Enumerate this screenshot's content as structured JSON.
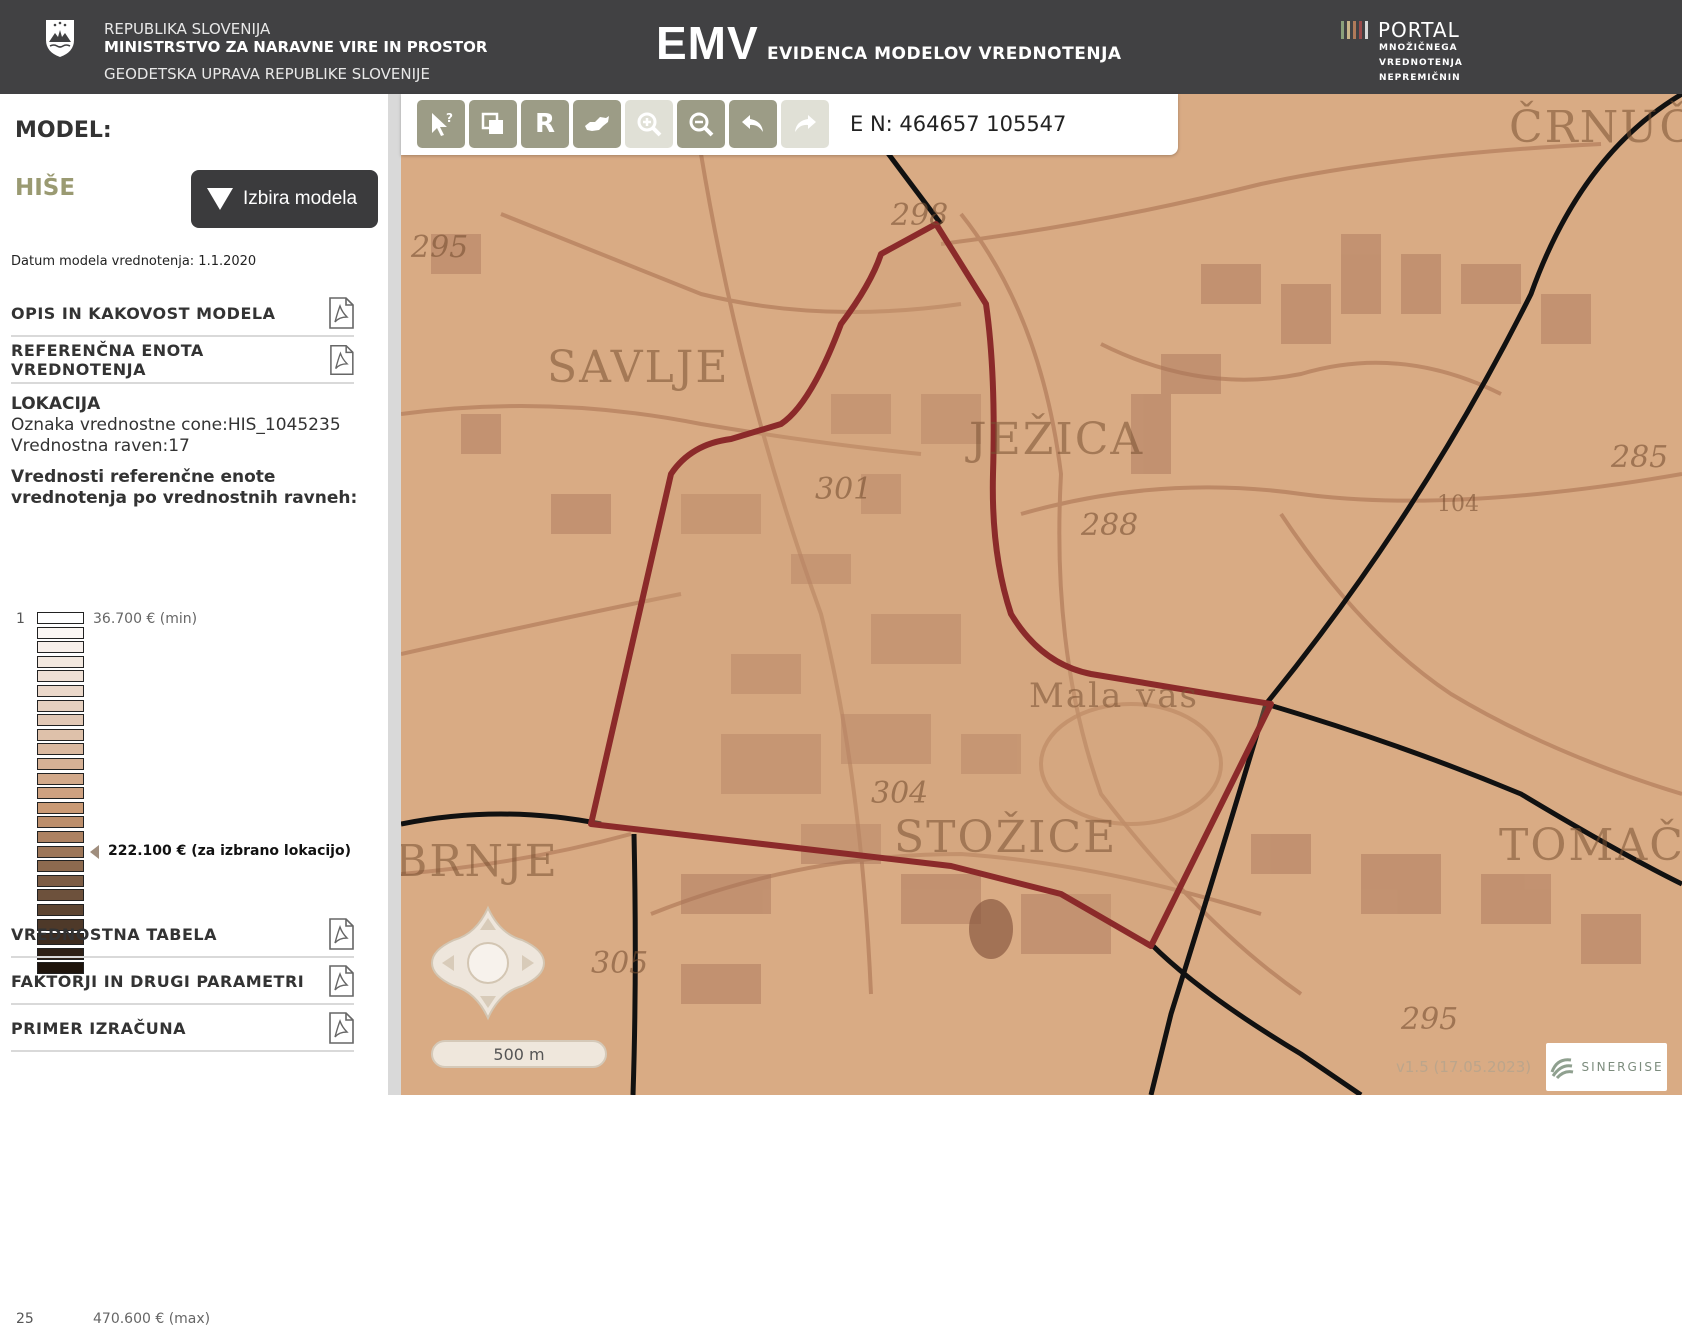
{
  "header": {
    "gov_line1": "REPUBLIKA SLOVENIJA",
    "gov_line2": "MINISTRSTVO ZA NARAVNE VIRE IN PROSTOR",
    "gov_line3": "GEODETSKA UPRAVA REPUBLIKE SLOVENIJE",
    "app_title": "EMV",
    "app_subtitle": "EVIDENCA MODELOV VREDNOTENJA",
    "portal_title": "PORTAL",
    "portal_sub1": "MNOŽIČNEGA",
    "portal_sub2": "VREDNOTENJA",
    "portal_sub3": "NEPREMIČNIN"
  },
  "sidebar": {
    "model_label": "MODEL:",
    "model_name": "HIŠE",
    "model_button": "Izbira modela",
    "model_date": "Datum modela vrednotenja:  1.1.2020",
    "sections_top": [
      {
        "label": "OPIS IN KAKOVOST MODELA"
      },
      {
        "label": "REFERENČNA ENOTA VREDNOTENJA"
      }
    ],
    "location_title": "LOKACIJA",
    "location_zone": "Oznaka vrednostne cone:HIS_1045235",
    "location_level": "Vrednostna raven:17",
    "values_heading": "Vrednosti referenčne enote vrednotenja po vrednostnih ravneh:",
    "legend": {
      "min_level": "1",
      "max_level": "25",
      "min_value": "36.700 € (min)",
      "max_value": "470.600 € (max)",
      "selected_level": 17,
      "selected_value": "222.100 € (za izbrano lokacijo)",
      "level_count": 25,
      "start_color": "#ffffff",
      "end_color": "#1e140c",
      "mid_color": "#c99873"
    },
    "sections_bottom": [
      {
        "label": "VREDNOSTNA TABELA"
      },
      {
        "label": "FAKTORJI IN DRUGI PARAMETRI"
      },
      {
        "label": "PRIMER IZRAČUNA"
      }
    ]
  },
  "map": {
    "coords": "E N: 464657 105547",
    "scale": "500 m",
    "version": "v1.5 (17.05.2023)",
    "attribution": "SINERGISE",
    "toolbar": [
      {
        "name": "query",
        "icon": "pointer-question-icon",
        "enabled": true
      },
      {
        "name": "layers",
        "icon": "layers-icon",
        "enabled": true
      },
      {
        "name": "reset",
        "icon": "r-letter-icon",
        "label": "R",
        "enabled": true
      },
      {
        "name": "full-extent",
        "icon": "slovenia-map-icon",
        "enabled": true
      },
      {
        "name": "zoom-in",
        "icon": "zoom-in-icon",
        "enabled": false
      },
      {
        "name": "zoom-out",
        "icon": "zoom-out-icon",
        "enabled": true
      },
      {
        "name": "undo",
        "icon": "undo-arrow-icon",
        "enabled": true
      },
      {
        "name": "redo",
        "icon": "redo-arrow-icon",
        "enabled": false
      }
    ],
    "places": [
      "SAVLJE",
      "JEŽICA",
      "Mala vas",
      "STOŽICE",
      "TOMAČE",
      "BRNJE",
      "ČRNUČE"
    ],
    "heights": [
      "295",
      "298",
      "301",
      "288",
      "285",
      "304",
      "305",
      "295",
      "104"
    ],
    "colors": {
      "map_bg": "#d9ab84",
      "zone_border": "#8b2a2a",
      "road": "#a8735a"
    }
  }
}
